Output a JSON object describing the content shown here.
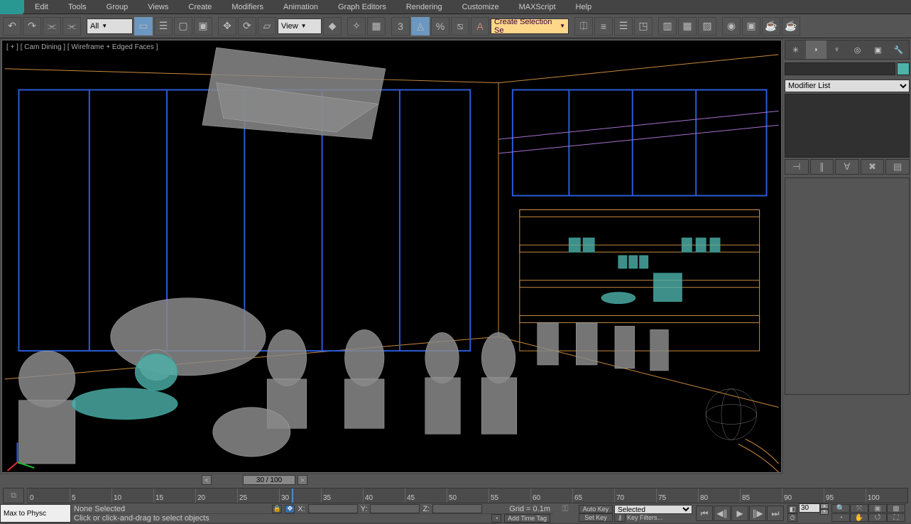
{
  "menu": {
    "items": [
      "Edit",
      "Tools",
      "Group",
      "Views",
      "Create",
      "Modifiers",
      "Animation",
      "Graph Editors",
      "Rendering",
      "Customize",
      "MAXScript",
      "Help"
    ]
  },
  "toolbar": {
    "all_dropdown": "All",
    "view_dropdown": "View",
    "selset_dropdown": "Create Selection Se"
  },
  "viewport": {
    "label": "[ + ] [ Cam Dining ] [ Wireframe + Edged Faces ]"
  },
  "cmdpanel": {
    "modifier_list": "Modifier List"
  },
  "timeslider": {
    "handle": "30 / 100"
  },
  "trackbar": {
    "ticks": [
      "0",
      "5",
      "10",
      "15",
      "20",
      "25",
      "30",
      "35",
      "40",
      "45",
      "50",
      "55",
      "60",
      "65",
      "70",
      "75",
      "80",
      "85",
      "90",
      "95",
      "100"
    ],
    "cursor_pct": 30
  },
  "status": {
    "script": "Max to Physc",
    "selection": "None Selected",
    "prompt": "Click or click-and-drag to select objects",
    "X": "X:",
    "Y": "Y:",
    "Z": "Z:",
    "grid": "Grid = 0.1m",
    "add_time_tag": "Add Time Tag",
    "auto_key": "Auto Key",
    "set_key": "Set Key",
    "sel_mode": "Selected",
    "key_filters": "Key Filters...",
    "frame": "30"
  }
}
